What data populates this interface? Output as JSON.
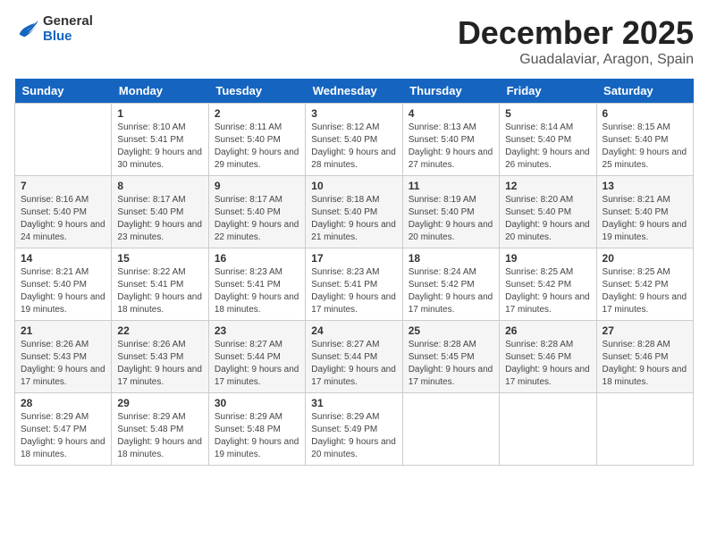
{
  "logo": {
    "general": "General",
    "blue": "Blue"
  },
  "header": {
    "month": "December 2025",
    "location": "Guadalaviar, Aragon, Spain"
  },
  "weekdays": [
    "Sunday",
    "Monday",
    "Tuesday",
    "Wednesday",
    "Thursday",
    "Friday",
    "Saturday"
  ],
  "weeks": [
    [
      {
        "day": "",
        "sunrise": "",
        "sunset": "",
        "daylight": ""
      },
      {
        "day": "1",
        "sunrise": "Sunrise: 8:10 AM",
        "sunset": "Sunset: 5:41 PM",
        "daylight": "Daylight: 9 hours and 30 minutes."
      },
      {
        "day": "2",
        "sunrise": "Sunrise: 8:11 AM",
        "sunset": "Sunset: 5:40 PM",
        "daylight": "Daylight: 9 hours and 29 minutes."
      },
      {
        "day": "3",
        "sunrise": "Sunrise: 8:12 AM",
        "sunset": "Sunset: 5:40 PM",
        "daylight": "Daylight: 9 hours and 28 minutes."
      },
      {
        "day": "4",
        "sunrise": "Sunrise: 8:13 AM",
        "sunset": "Sunset: 5:40 PM",
        "daylight": "Daylight: 9 hours and 27 minutes."
      },
      {
        "day": "5",
        "sunrise": "Sunrise: 8:14 AM",
        "sunset": "Sunset: 5:40 PM",
        "daylight": "Daylight: 9 hours and 26 minutes."
      },
      {
        "day": "6",
        "sunrise": "Sunrise: 8:15 AM",
        "sunset": "Sunset: 5:40 PM",
        "daylight": "Daylight: 9 hours and 25 minutes."
      }
    ],
    [
      {
        "day": "7",
        "sunrise": "Sunrise: 8:16 AM",
        "sunset": "Sunset: 5:40 PM",
        "daylight": "Daylight: 9 hours and 24 minutes."
      },
      {
        "day": "8",
        "sunrise": "Sunrise: 8:17 AM",
        "sunset": "Sunset: 5:40 PM",
        "daylight": "Daylight: 9 hours and 23 minutes."
      },
      {
        "day": "9",
        "sunrise": "Sunrise: 8:17 AM",
        "sunset": "Sunset: 5:40 PM",
        "daylight": "Daylight: 9 hours and 22 minutes."
      },
      {
        "day": "10",
        "sunrise": "Sunrise: 8:18 AM",
        "sunset": "Sunset: 5:40 PM",
        "daylight": "Daylight: 9 hours and 21 minutes."
      },
      {
        "day": "11",
        "sunrise": "Sunrise: 8:19 AM",
        "sunset": "Sunset: 5:40 PM",
        "daylight": "Daylight: 9 hours and 20 minutes."
      },
      {
        "day": "12",
        "sunrise": "Sunrise: 8:20 AM",
        "sunset": "Sunset: 5:40 PM",
        "daylight": "Daylight: 9 hours and 20 minutes."
      },
      {
        "day": "13",
        "sunrise": "Sunrise: 8:21 AM",
        "sunset": "Sunset: 5:40 PM",
        "daylight": "Daylight: 9 hours and 19 minutes."
      }
    ],
    [
      {
        "day": "14",
        "sunrise": "Sunrise: 8:21 AM",
        "sunset": "Sunset: 5:40 PM",
        "daylight": "Daylight: 9 hours and 19 minutes."
      },
      {
        "day": "15",
        "sunrise": "Sunrise: 8:22 AM",
        "sunset": "Sunset: 5:41 PM",
        "daylight": "Daylight: 9 hours and 18 minutes."
      },
      {
        "day": "16",
        "sunrise": "Sunrise: 8:23 AM",
        "sunset": "Sunset: 5:41 PM",
        "daylight": "Daylight: 9 hours and 18 minutes."
      },
      {
        "day": "17",
        "sunrise": "Sunrise: 8:23 AM",
        "sunset": "Sunset: 5:41 PM",
        "daylight": "Daylight: 9 hours and 17 minutes."
      },
      {
        "day": "18",
        "sunrise": "Sunrise: 8:24 AM",
        "sunset": "Sunset: 5:42 PM",
        "daylight": "Daylight: 9 hours and 17 minutes."
      },
      {
        "day": "19",
        "sunrise": "Sunrise: 8:25 AM",
        "sunset": "Sunset: 5:42 PM",
        "daylight": "Daylight: 9 hours and 17 minutes."
      },
      {
        "day": "20",
        "sunrise": "Sunrise: 8:25 AM",
        "sunset": "Sunset: 5:42 PM",
        "daylight": "Daylight: 9 hours and 17 minutes."
      }
    ],
    [
      {
        "day": "21",
        "sunrise": "Sunrise: 8:26 AM",
        "sunset": "Sunset: 5:43 PM",
        "daylight": "Daylight: 9 hours and 17 minutes."
      },
      {
        "day": "22",
        "sunrise": "Sunrise: 8:26 AM",
        "sunset": "Sunset: 5:43 PM",
        "daylight": "Daylight: 9 hours and 17 minutes."
      },
      {
        "day": "23",
        "sunrise": "Sunrise: 8:27 AM",
        "sunset": "Sunset: 5:44 PM",
        "daylight": "Daylight: 9 hours and 17 minutes."
      },
      {
        "day": "24",
        "sunrise": "Sunrise: 8:27 AM",
        "sunset": "Sunset: 5:44 PM",
        "daylight": "Daylight: 9 hours and 17 minutes."
      },
      {
        "day": "25",
        "sunrise": "Sunrise: 8:28 AM",
        "sunset": "Sunset: 5:45 PM",
        "daylight": "Daylight: 9 hours and 17 minutes."
      },
      {
        "day": "26",
        "sunrise": "Sunrise: 8:28 AM",
        "sunset": "Sunset: 5:46 PM",
        "daylight": "Daylight: 9 hours and 17 minutes."
      },
      {
        "day": "27",
        "sunrise": "Sunrise: 8:28 AM",
        "sunset": "Sunset: 5:46 PM",
        "daylight": "Daylight: 9 hours and 18 minutes."
      }
    ],
    [
      {
        "day": "28",
        "sunrise": "Sunrise: 8:29 AM",
        "sunset": "Sunset: 5:47 PM",
        "daylight": "Daylight: 9 hours and 18 minutes."
      },
      {
        "day": "29",
        "sunrise": "Sunrise: 8:29 AM",
        "sunset": "Sunset: 5:48 PM",
        "daylight": "Daylight: 9 hours and 18 minutes."
      },
      {
        "day": "30",
        "sunrise": "Sunrise: 8:29 AM",
        "sunset": "Sunset: 5:48 PM",
        "daylight": "Daylight: 9 hours and 19 minutes."
      },
      {
        "day": "31",
        "sunrise": "Sunrise: 8:29 AM",
        "sunset": "Sunset: 5:49 PM",
        "daylight": "Daylight: 9 hours and 20 minutes."
      },
      {
        "day": "",
        "sunrise": "",
        "sunset": "",
        "daylight": ""
      },
      {
        "day": "",
        "sunrise": "",
        "sunset": "",
        "daylight": ""
      },
      {
        "day": "",
        "sunrise": "",
        "sunset": "",
        "daylight": ""
      }
    ]
  ]
}
